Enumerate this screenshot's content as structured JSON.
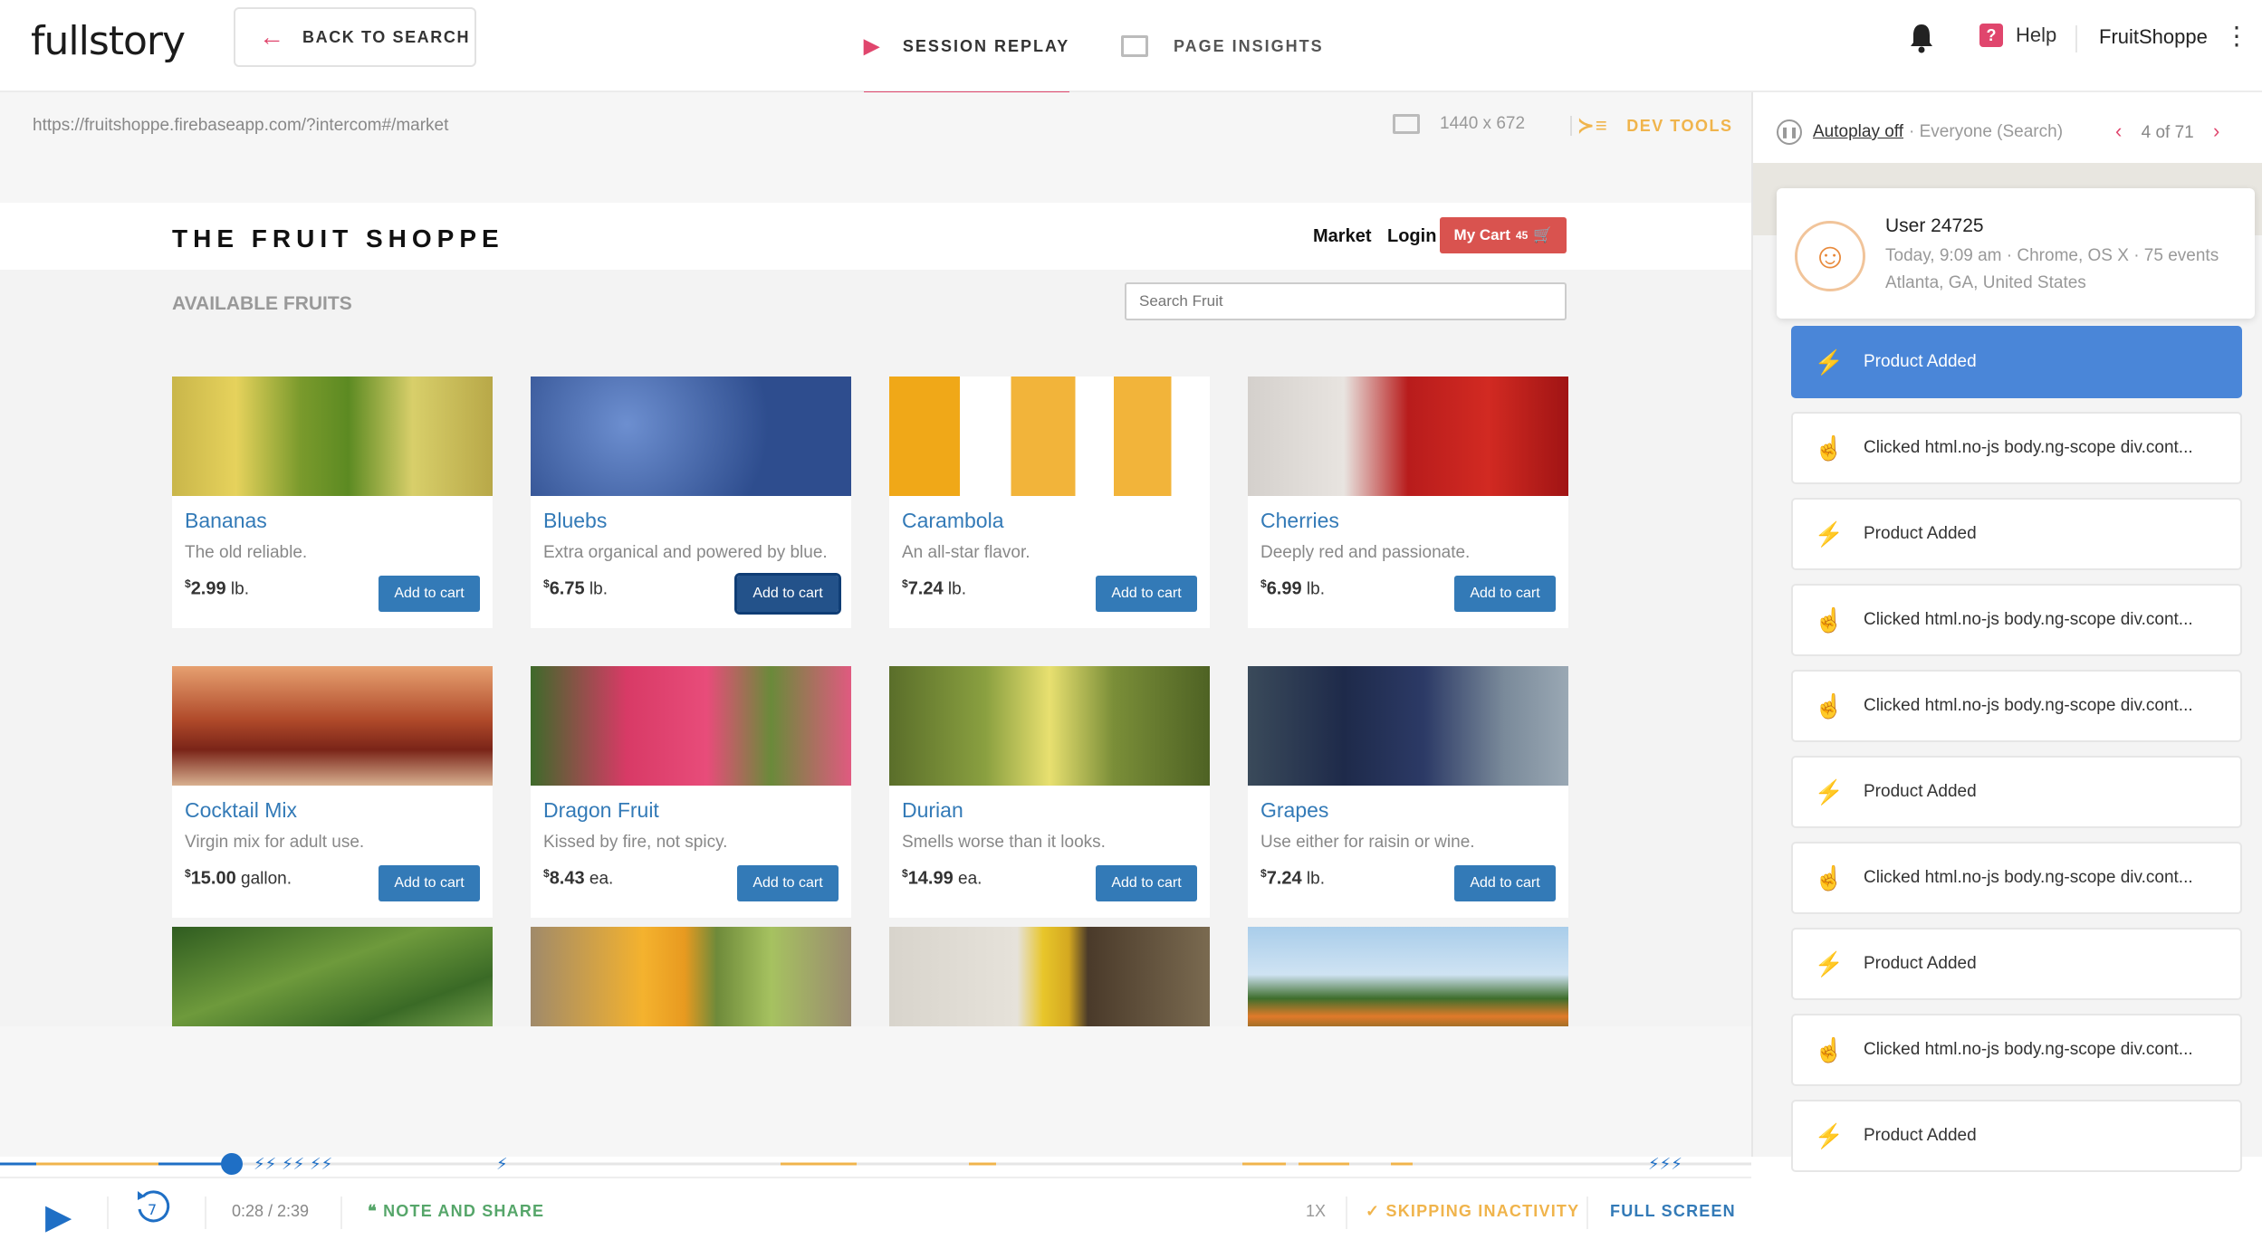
{
  "app": {
    "logo": "fullstory",
    "back_label": "BACK TO SEARCH",
    "account": "FruitShoppe",
    "help_label": "Help"
  },
  "tabs": [
    {
      "label": "SESSION REPLAY",
      "active": true
    },
    {
      "label": "PAGE INSIGHTS",
      "active": false
    }
  ],
  "viewer": {
    "url": "https://fruitshoppe.firebaseapp.com/?intercom#/market",
    "resolution": "1440 x 672",
    "devtools_label": "DEV TOOLS"
  },
  "site": {
    "brand": "THE FRUIT SHOPPE",
    "nav": [
      "Market",
      "Login"
    ],
    "cart_label": "My Cart",
    "cart_count": "45",
    "section_title": "AVAILABLE FRUITS",
    "search_placeholder": "Search Fruit",
    "add_label": "Add to cart",
    "products": [
      {
        "name": "Bananas",
        "desc": "The old reliable.",
        "price": "2.99",
        "unit": "lb."
      },
      {
        "name": "Bluebs",
        "desc": "Extra organical and powered by blue.",
        "price": "6.75",
        "unit": "lb."
      },
      {
        "name": "Carambola",
        "desc": "An all-star flavor.",
        "price": "7.24",
        "unit": "lb."
      },
      {
        "name": "Cherries",
        "desc": "Deeply red and passionate.",
        "price": "6.99",
        "unit": "lb."
      },
      {
        "name": "Cocktail Mix",
        "desc": "Virgin mix for adult use.",
        "price": "15.00",
        "unit": "gallon."
      },
      {
        "name": "Dragon Fruit",
        "desc": "Kissed by fire, not spicy.",
        "price": "8.43",
        "unit": "ea."
      },
      {
        "name": "Durian",
        "desc": "Smells worse than it looks.",
        "price": "14.99",
        "unit": "ea."
      },
      {
        "name": "Grapes",
        "desc": "Use either for raisin or wine.",
        "price": "7.24",
        "unit": "lb."
      }
    ]
  },
  "player": {
    "time": "0:28 / 2:39",
    "rewind_seconds": "7",
    "note_label": "NOTE AND SHARE",
    "speed": "1X",
    "skip_label": "✓ SKIPPING INACTIVITY",
    "fullscreen_label": "FULL SCREEN",
    "progress_fraction": 0.18
  },
  "sidebar": {
    "autoplay_label": "Autoplay off",
    "segment": "· Everyone (Search)",
    "position": "4 of 71",
    "user": {
      "name": "User 24725",
      "meta": "Today, 9:09 am · Chrome, OS X · 75 events",
      "location": "Atlanta,  GA,  United States"
    },
    "events": [
      {
        "type": "lightning-icon",
        "label": "Product Added",
        "selected": true
      },
      {
        "type": "pointer-icon",
        "label": "Clicked html.no-js body.ng-scope div.cont..."
      },
      {
        "type": "lightning-icon",
        "label": "Product Added"
      },
      {
        "type": "pointer-icon",
        "label": "Clicked html.no-js body.ng-scope div.cont..."
      },
      {
        "type": "pointer-icon",
        "label": "Clicked html.no-js body.ng-scope div.cont..."
      },
      {
        "type": "lightning-icon",
        "label": "Product Added"
      },
      {
        "type": "pointer-icon",
        "label": "Clicked html.no-js body.ng-scope div.cont..."
      },
      {
        "type": "lightning-icon",
        "label": "Product Added"
      },
      {
        "type": "pointer-icon",
        "label": "Clicked html.no-js body.ng-scope div.cont..."
      },
      {
        "type": "lightning-icon",
        "label": "Product Added"
      }
    ]
  },
  "colors": {
    "accent": "#e0466d",
    "primary": "#337ab7",
    "selected_event": "#4a86d8",
    "warning": "#f0b44c",
    "note": "#56a66a"
  }
}
